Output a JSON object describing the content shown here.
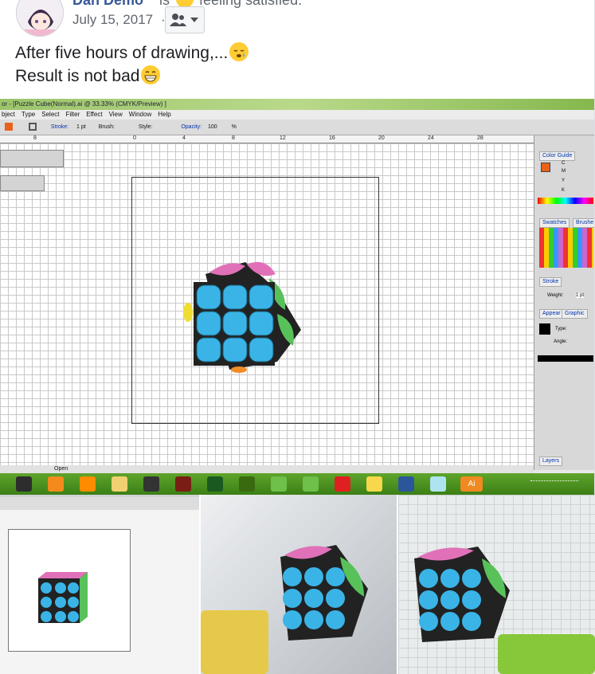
{
  "post": {
    "author": "Dan Demo",
    "feeling_connector": "is",
    "feeling": "feeling satisfied.",
    "date": "July 15, 2017",
    "date_separator": "·",
    "text_line1": "After five hours of drawing,...",
    "text_line2": "Result is not bad"
  },
  "icons": {
    "feeling": "slightly-smiling-face-icon",
    "audience": "friends-icon",
    "audience_dropdown": "caret-down-icon",
    "line1_emoji": "sleepy-face-icon",
    "line2_emoji": "grinning-face-icon"
  },
  "screenshot": {
    "window_title": "or - [Puzzle Cube(Normal).ai @ 33.33% (CMYK/Preview) ]",
    "menu": [
      "bject",
      "Type",
      "Select",
      "Filter",
      "Effect",
      "View",
      "Window",
      "Help"
    ],
    "control_bar": {
      "stroke_label": "Stroke:",
      "stroke_value": "1 pt",
      "brush_label": "Brush:",
      "style_label": "Style:",
      "opacity_label": "Opacity:",
      "opacity_value": "100",
      "opacity_unit": "%"
    },
    "ruler_ticks": [
      "8",
      "0",
      "4",
      "8",
      "12",
      "16",
      "20",
      "24",
      "28"
    ],
    "panels": {
      "color_guide": "Color Guide",
      "color_channels": [
        "C",
        "M",
        "Y",
        "K"
      ],
      "swatches": "Swatches",
      "brushes": "Brushe",
      "stroke": "Stroke",
      "weight_label": "Weight:",
      "weight_value": "1 pt",
      "appearance": "Appear",
      "graphic": "Graphic",
      "type_label": "Type:",
      "angle_label": "Angle:",
      "layers": "Layers"
    },
    "status_open": "Open",
    "taskbar_label_ai": "Ai"
  },
  "colors": {
    "link": "#385898",
    "meta": "#616770",
    "cube_tile": "#3ab4e6",
    "cube_leaf_pink": "#e071b8",
    "cube_leaf_green": "#58c15a"
  }
}
